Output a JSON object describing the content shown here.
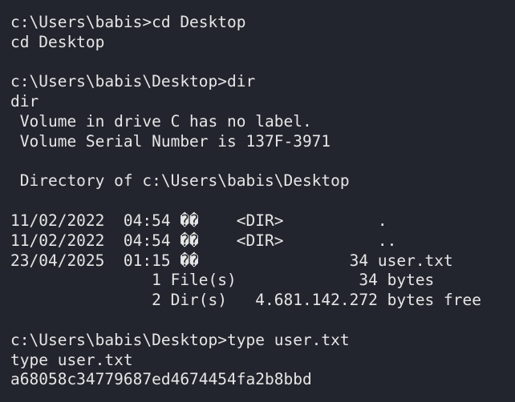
{
  "terminal": {
    "lines": [
      "c:\\Users\\babis>cd Desktop",
      "cd Desktop",
      "",
      "c:\\Users\\babis\\Desktop>dir",
      "dir",
      " Volume in drive C has no label.",
      " Volume Serial Number is 137F-3971",
      "",
      " Directory of c:\\Users\\babis\\Desktop",
      "",
      "11/02/2022  04:54 ��    <DIR>          .",
      "11/02/2022  04:54 ��    <DIR>          ..",
      "23/04/2025  01:15 ��                34 user.txt",
      "               1 File(s)             34 bytes",
      "               2 Dir(s)   4.681.142.272 bytes free",
      "",
      "c:\\Users\\babis\\Desktop>type user.txt",
      "type user.txt",
      "a68058c34779687ed4674454fa2b8bbd"
    ]
  },
  "colors": {
    "background": "#23252e",
    "text": "#e6e6e6"
  }
}
